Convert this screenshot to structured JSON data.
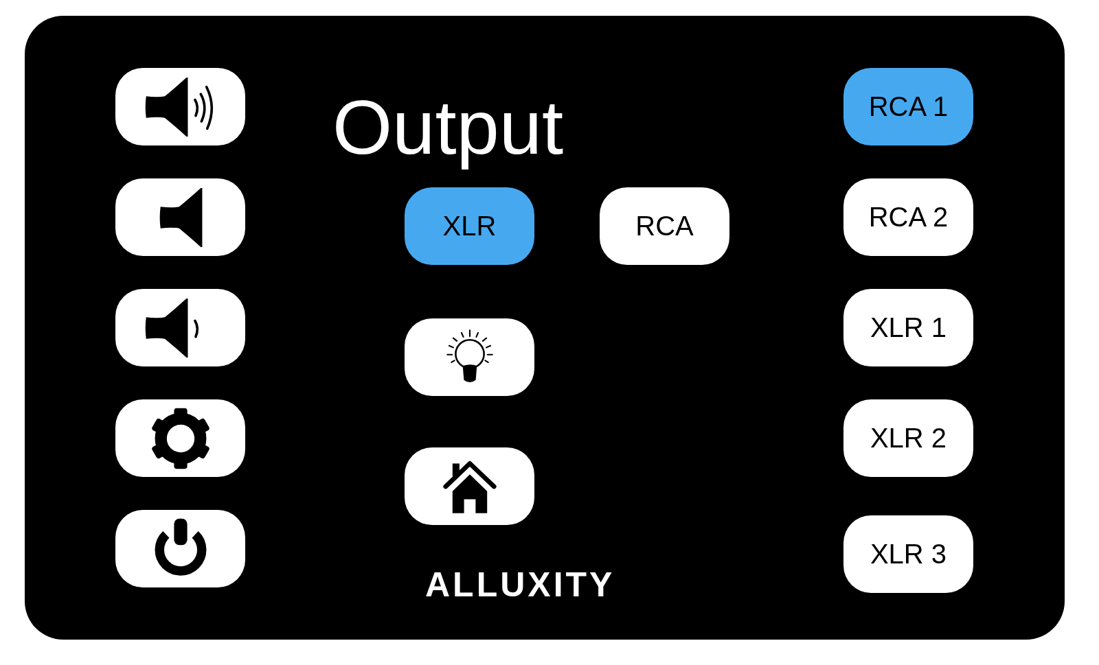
{
  "title": "Output",
  "side_controls": [
    {
      "kind": "volume-up"
    },
    {
      "kind": "mute"
    },
    {
      "kind": "volume-down"
    },
    {
      "kind": "settings"
    },
    {
      "kind": "power"
    }
  ],
  "modes": [
    {
      "label": "XLR",
      "selected": true
    },
    {
      "label": "RCA",
      "selected": false
    }
  ],
  "actions": [
    {
      "kind": "light"
    },
    {
      "kind": "home"
    }
  ],
  "logo": "ALLUXITY",
  "outputs": [
    {
      "label": "RCA 1",
      "selected": true
    },
    {
      "label": "RCA 2",
      "selected": false
    },
    {
      "label": "XLR 1",
      "selected": false
    },
    {
      "label": "XLR 2",
      "selected": false
    },
    {
      "label": "XLR 3",
      "selected": false
    }
  ]
}
